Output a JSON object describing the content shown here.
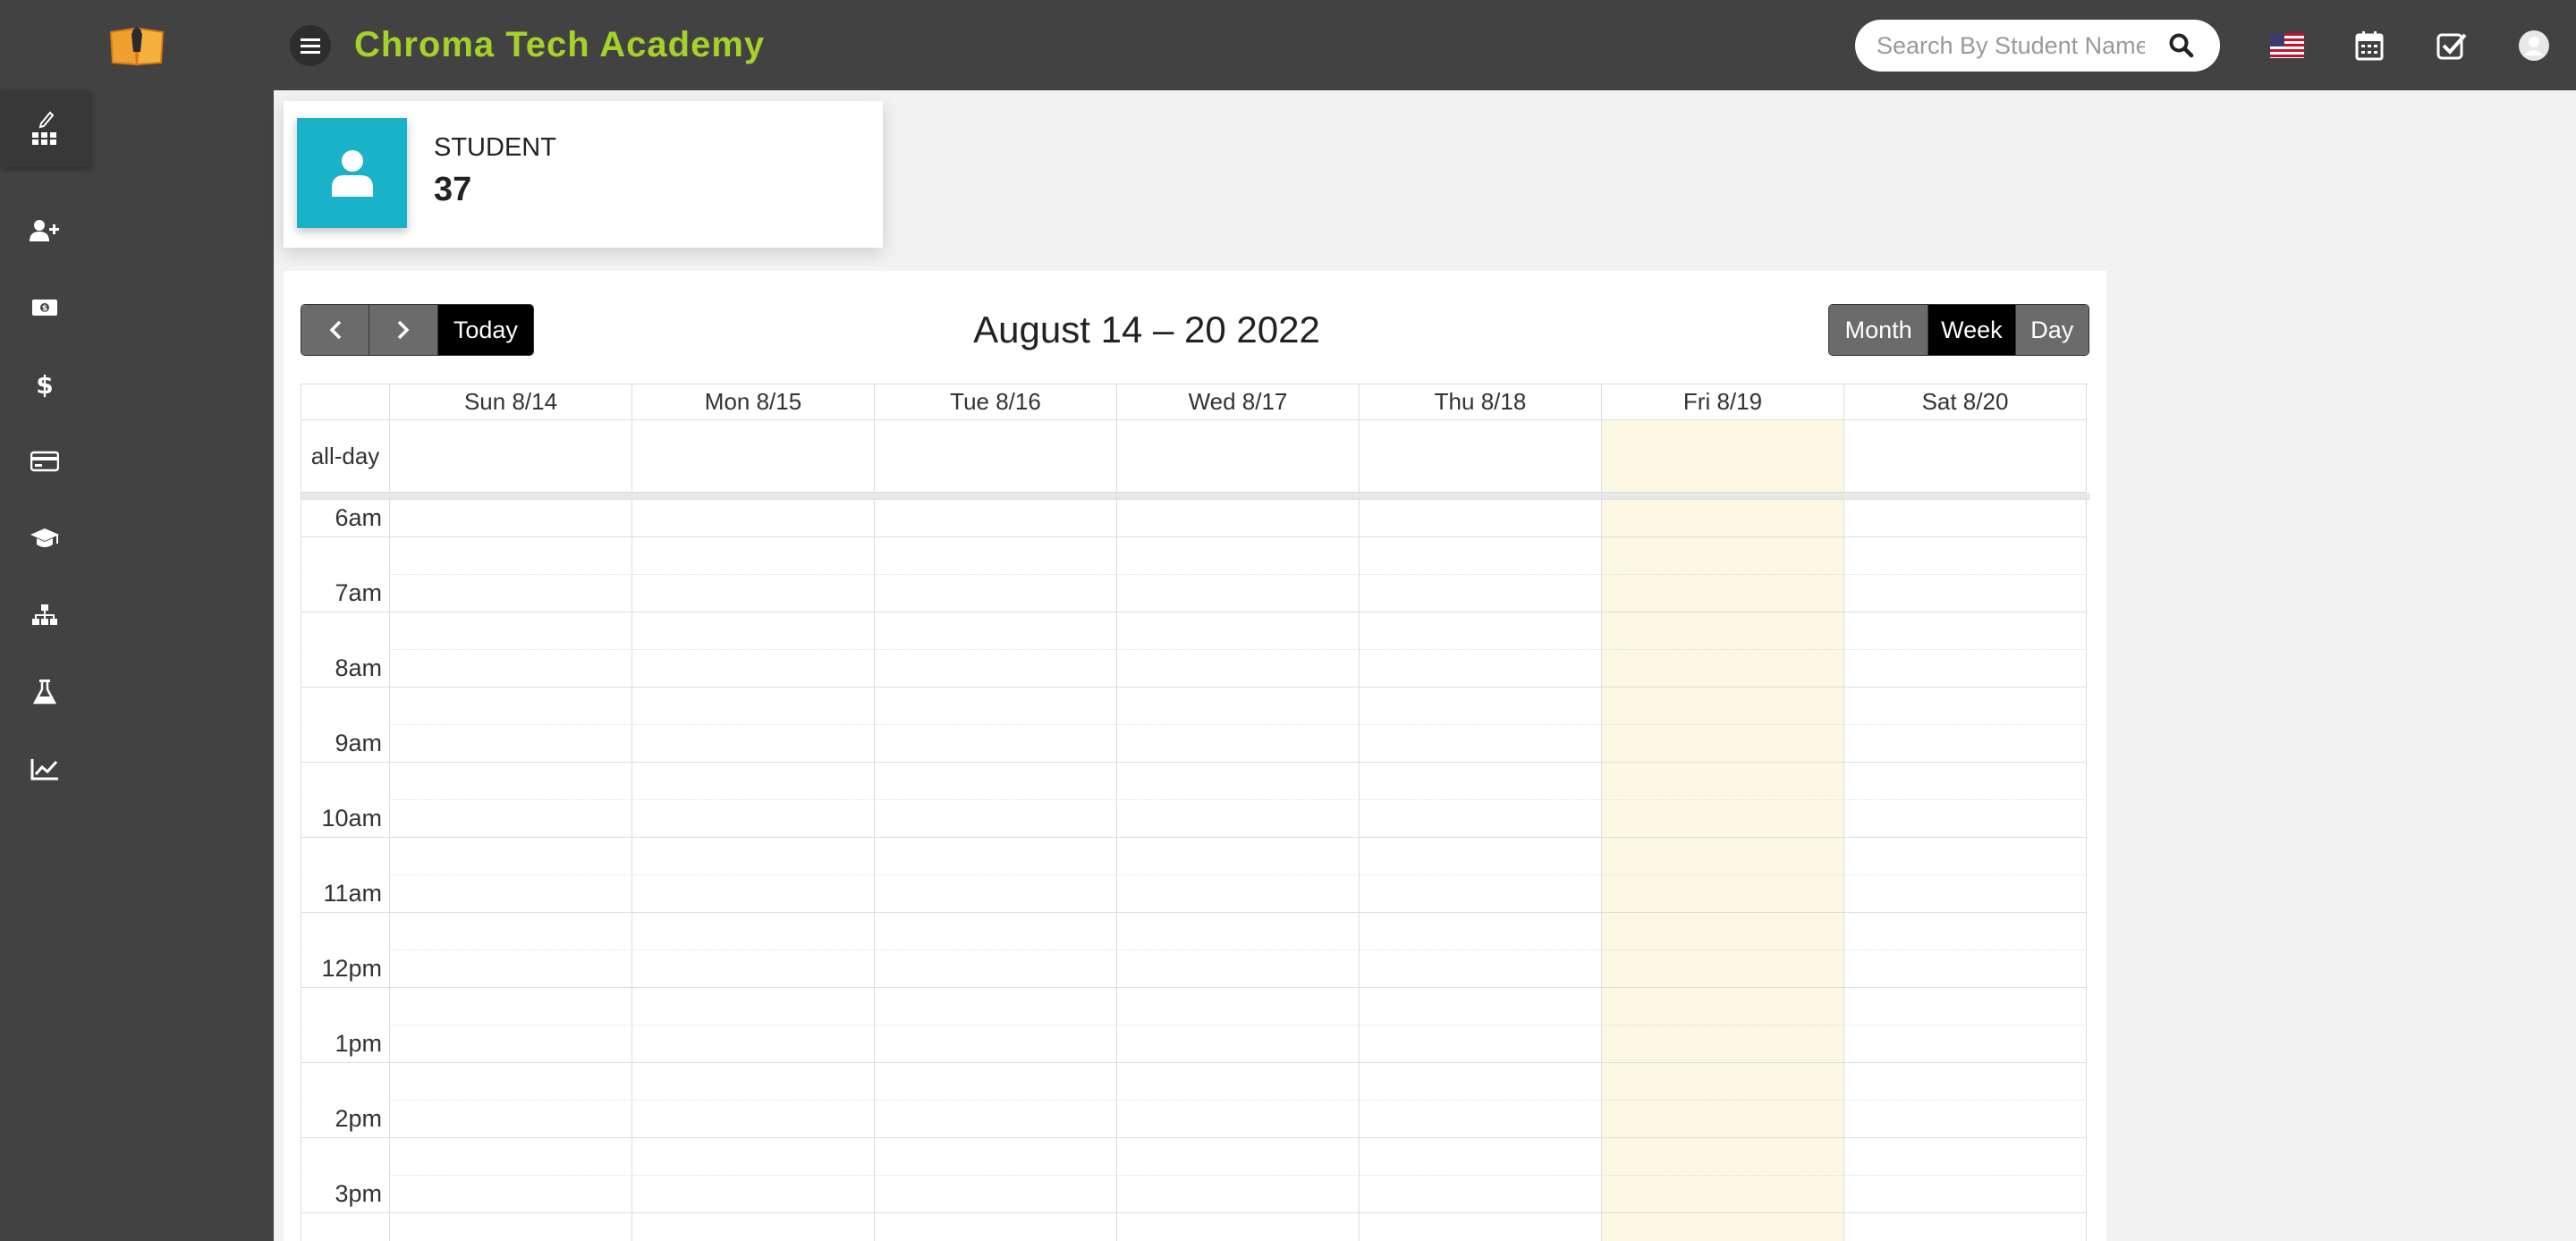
{
  "header": {
    "brand": "Chroma Tech Academy",
    "search_placeholder": "Search By Student Name"
  },
  "stats_card": {
    "label": "STUDENT",
    "value": "37"
  },
  "calendar": {
    "title": "August 14 – 20 2022",
    "today_label": "Today",
    "views": [
      "Month",
      "Week",
      "Day"
    ],
    "active_view": "Week",
    "all_day_label": "all-day",
    "days": [
      "Sun 8/14",
      "Mon 8/15",
      "Tue 8/16",
      "Wed 8/17",
      "Thu 8/18",
      "Fri 8/19",
      "Sat 8/20"
    ],
    "highlighted_day": "Fri 8/19",
    "times": [
      "6am",
      "7am",
      "8am",
      "9am",
      "10am",
      "11am",
      "12pm",
      "1pm",
      "2pm",
      "3pm"
    ]
  },
  "colors": {
    "topbar": "#424242",
    "brand": "#a5d22a",
    "card_accent": "#1ab2c8",
    "today_highlight": "#fcf8e3"
  },
  "icons": {
    "sidebar": [
      "dashboard-icon",
      "add-user-icon",
      "money-bill-icon",
      "dollar-icon",
      "credit-card-icon",
      "graduation-cap-icon",
      "sitemap-icon",
      "flask-icon",
      "line-chart-icon"
    ],
    "topbar": [
      "us-flag-icon",
      "calendar-icon",
      "check-square-icon",
      "user-avatar-icon"
    ]
  }
}
